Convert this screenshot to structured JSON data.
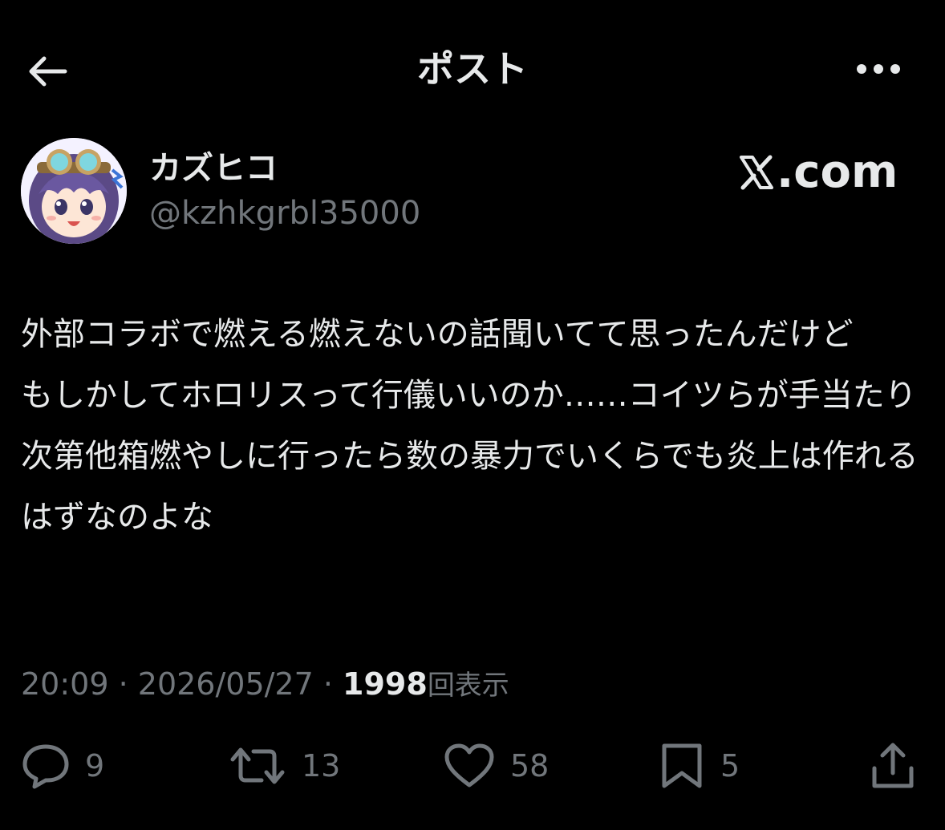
{
  "header": {
    "title": "ポスト"
  },
  "author": {
    "display_name": "カズヒコ",
    "handle": "@kzhkgrbl35000"
  },
  "watermark": {
    "text": ".com"
  },
  "post": {
    "text": "外部コラボで燃える燃えないの話聞いてて思ったんだけど\nもしかしてホロリスって行儀いいのか……コイツらが手当たり次第他箱燃やしに行ったら数の暴力でいくらでも炎上は作れるはずなのよな"
  },
  "meta": {
    "time": "20:09",
    "separator1": " · ",
    "date": "2026/05/27",
    "separator2": " · ",
    "views_count": "1998",
    "views_label": "回表示"
  },
  "actions": {
    "replies": "9",
    "reposts": "13",
    "likes": "58",
    "bookmarks": "5"
  },
  "icons": {
    "back": "arrow-left-icon",
    "more": "more-horizontal-icon",
    "reply": "reply-icon",
    "repost": "repost-icon",
    "like": "heart-icon",
    "bookmark": "bookmark-icon",
    "share": "share-icon"
  },
  "colors": {
    "background": "#000000",
    "primary_text": "#e7e9ea",
    "secondary_text": "#71767b"
  }
}
